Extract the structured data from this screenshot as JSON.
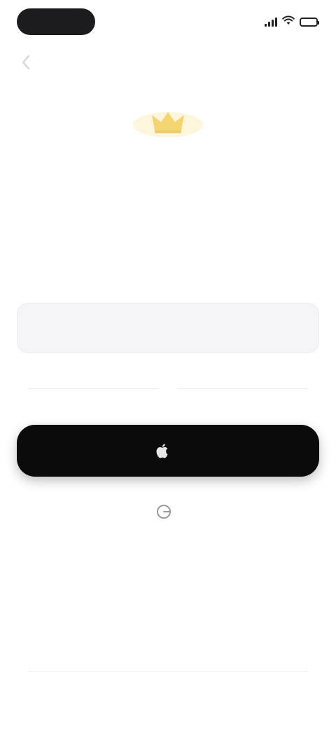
{
  "status_bar": {
    "time": "",
    "icons": [
      "cellular-icon",
      "wifi-icon",
      "battery-icon"
    ]
  },
  "header": {
    "back_icon": "chevron-left-icon"
  },
  "logo": {
    "icon": "crown-icon",
    "color": "#f2c94c"
  },
  "title": "",
  "subtitle": "",
  "email": {
    "label": "",
    "placeholder": "",
    "value": ""
  },
  "divider": {
    "text": ""
  },
  "apple_button": {
    "icon": "apple-icon",
    "label": "",
    "background": "#0b0b0b"
  },
  "google_button": {
    "icon": "google-icon",
    "label": ""
  },
  "footer": {
    "text": ""
  }
}
